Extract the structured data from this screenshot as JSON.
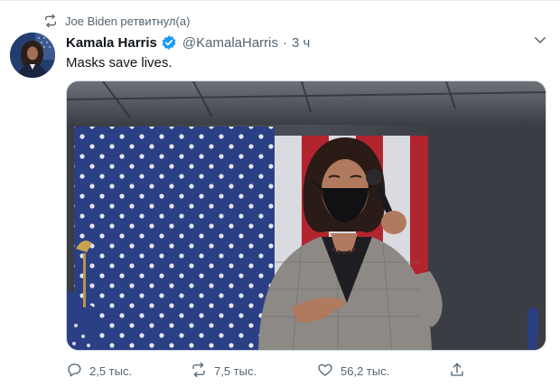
{
  "retweet": {
    "label": "Joe Biden ретвитнул(а)",
    "icon": "retweet-icon"
  },
  "tweet": {
    "name": "Kamala Harris",
    "verified": true,
    "handle": "@KamalaHarris",
    "separator": "·",
    "time": "3 ч",
    "text": "Masks save lives."
  },
  "actions": {
    "reply": {
      "icon": "reply-icon",
      "count": "2,5 тыс."
    },
    "retweet": {
      "icon": "retweet-icon",
      "count": "7,5 тыс."
    },
    "like": {
      "icon": "heart-icon",
      "count": "56,2 тыс."
    },
    "share": {
      "icon": "share-icon"
    }
  },
  "colors": {
    "accent": "#1d9bf0",
    "secondary_text": "#536471",
    "primary_text": "#0f1419"
  }
}
